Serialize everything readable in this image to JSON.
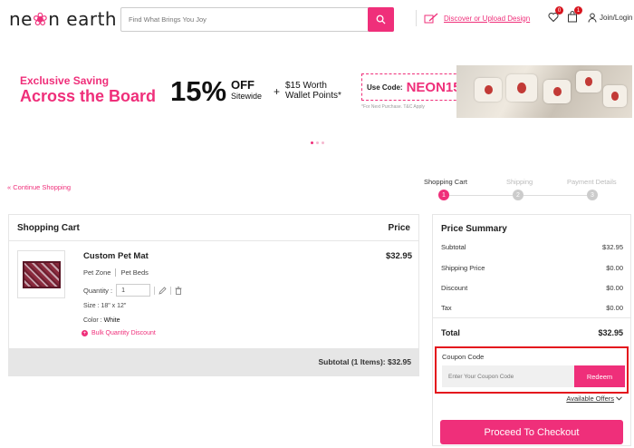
{
  "header": {
    "logo_text": "ne",
    "logo_flower": "❀",
    "logo_text2": "n earth",
    "search_placeholder": "Find What Brings You Joy",
    "discover_label": "Discover or Upload Design",
    "wishlist_count": "0",
    "bag_count": "1",
    "login_label": "Join/Login"
  },
  "banner": {
    "line1": "Exclusive Saving",
    "line2": "Across the Board",
    "percent": "15%",
    "off": "OFF",
    "sitewide": "Sitewide",
    "plus": "+",
    "wallet_line1": "$15 Worth",
    "wallet_line2": "Wallet Points*",
    "use_code_label": "Use Code:",
    "code": "NEON15",
    "note": "*For Next Purchase. T&C Apply"
  },
  "nav": {
    "continue_label": "Continue Shopping"
  },
  "steps": [
    {
      "label": "Shopping Cart",
      "num": "1"
    },
    {
      "label": "Shipping",
      "num": "2"
    },
    {
      "label": "Payment Details",
      "num": "3"
    }
  ],
  "cart": {
    "title": "Shopping Cart",
    "price_header": "Price",
    "item": {
      "name": "Custom Pet Mat",
      "price": "$32.95",
      "category1": "Pet Zone",
      "category2": "Pet Beds",
      "quantity_label": "Quantity :",
      "quantity": "1",
      "size": "Size : 18\" x 12\"",
      "color_label": "Color : ",
      "color": "White",
      "bulk_label": "Bulk Quantity Discount"
    },
    "subtotal": "Subtotal (1 Items):  $32.95"
  },
  "summary": {
    "title": "Price Summary",
    "rows": [
      {
        "label": "Subtotal",
        "value": "$32.95"
      },
      {
        "label": "Shipping Price",
        "value": "$0.00"
      },
      {
        "label": "Discount",
        "value": "$0.00"
      },
      {
        "label": "Tax",
        "value": "$0.00"
      }
    ],
    "total_label": "Total",
    "total_value": "$32.95",
    "coupon_label": "Coupon Code",
    "coupon_placeholder": "Enter Your Coupon Code",
    "redeem_label": "Redeem",
    "available_offers": "Available Offers",
    "checkout_label": "Proceed To Checkout"
  },
  "colors": {
    "accent": "#ef2f7a",
    "highlight": "#e4151d"
  }
}
